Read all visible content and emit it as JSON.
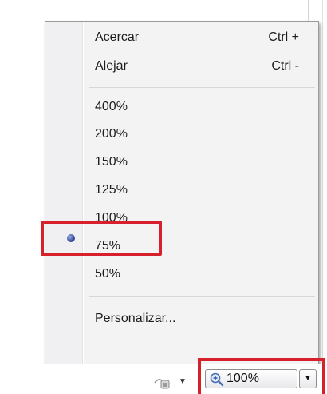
{
  "menu": {
    "zoom_in": {
      "label": "Acercar",
      "shortcut": "Ctrl +"
    },
    "zoom_out": {
      "label": "Alejar",
      "shortcut": "Ctrl -"
    },
    "levels": [
      "400%",
      "200%",
      "150%",
      "125%",
      "100%",
      "75%",
      "50%"
    ],
    "selected_level": "100%",
    "custom": "Personalizar..."
  },
  "statusbar": {
    "zoom_value": "100%",
    "icon": "protected-mode-icon"
  },
  "colors": {
    "highlight": "#d6202b",
    "radio": "#3b4ea0"
  }
}
